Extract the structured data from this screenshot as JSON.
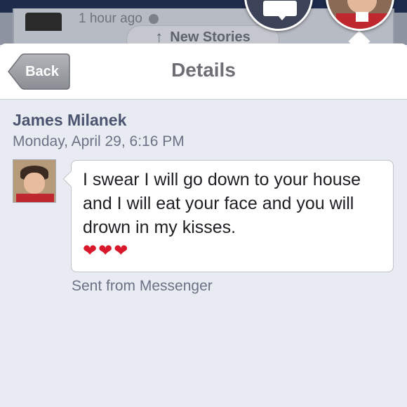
{
  "feed": {
    "time_ago": "1 hour ago",
    "new_stories_label": "New Stories"
  },
  "nav": {
    "back_label": "Back",
    "title": "Details"
  },
  "message": {
    "sender_name": "James Milanek",
    "timestamp": "Monday, April 29, 6:16 PM",
    "text": "I swear I will go down to your house and I will eat your face and you will drown in my kisses.",
    "hearts": "❤❤❤",
    "sent_from": "Sent from Messenger"
  },
  "colors": {
    "accent_text": "#4b5570",
    "background": "#e9ebf2",
    "heart": "#d9182b"
  },
  "icons": [
    "globe-icon",
    "arrow-up-icon",
    "message-bubble-icon",
    "back-arrow-icon",
    "heart-icon"
  ]
}
